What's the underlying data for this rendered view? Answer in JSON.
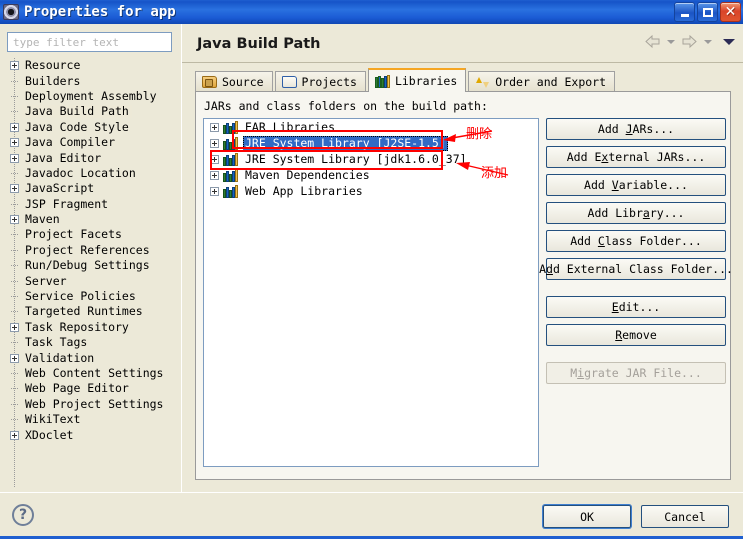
{
  "window": {
    "title": "Properties for app",
    "icon": "properties-gear-icon",
    "controls": {
      "minimize": "minimize",
      "maximize": "maximize",
      "close": "close"
    }
  },
  "sidebar": {
    "filter": {
      "placeholder": "type filter text",
      "value": ""
    },
    "items": [
      {
        "label": "Resource",
        "expandable": true,
        "selected": false
      },
      {
        "label": "Builders",
        "expandable": false,
        "selected": false
      },
      {
        "label": "Deployment Assembly",
        "expandable": false,
        "selected": false
      },
      {
        "label": "Java Build Path",
        "expandable": false,
        "selected": true
      },
      {
        "label": "Java Code Style",
        "expandable": true,
        "selected": false
      },
      {
        "label": "Java Compiler",
        "expandable": true,
        "selected": false
      },
      {
        "label": "Java Editor",
        "expandable": true,
        "selected": false
      },
      {
        "label": "Javadoc Location",
        "expandable": false,
        "selected": false
      },
      {
        "label": "JavaScript",
        "expandable": true,
        "selected": false
      },
      {
        "label": "JSP Fragment",
        "expandable": false,
        "selected": false
      },
      {
        "label": "Maven",
        "expandable": true,
        "selected": false
      },
      {
        "label": "Project Facets",
        "expandable": false,
        "selected": false
      },
      {
        "label": "Project References",
        "expandable": false,
        "selected": false
      },
      {
        "label": "Run/Debug Settings",
        "expandable": false,
        "selected": false
      },
      {
        "label": "Server",
        "expandable": false,
        "selected": false
      },
      {
        "label": "Service Policies",
        "expandable": false,
        "selected": false
      },
      {
        "label": "Targeted Runtimes",
        "expandable": false,
        "selected": false
      },
      {
        "label": "Task Repository",
        "expandable": true,
        "selected": false
      },
      {
        "label": "Task Tags",
        "expandable": false,
        "selected": false
      },
      {
        "label": "Validation",
        "expandable": true,
        "selected": false
      },
      {
        "label": "Web Content Settings",
        "expandable": false,
        "selected": false
      },
      {
        "label": "Web Page Editor",
        "expandable": false,
        "selected": false
      },
      {
        "label": "Web Project Settings",
        "expandable": false,
        "selected": false
      },
      {
        "label": "WikiText",
        "expandable": false,
        "selected": false
      },
      {
        "label": "XDoclet",
        "expandable": true,
        "selected": false
      }
    ]
  },
  "main": {
    "page_title": "Java Build Path",
    "nav": {
      "back_icon": "back-arrow-icon",
      "back_dropdown_icon": "chevron-down-icon",
      "forward_icon": "forward-arrow-icon",
      "forward_dropdown_icon": "chevron-down-icon",
      "menu_icon": "view-menu-chevron-icon"
    },
    "tabs": [
      {
        "label": "Source",
        "icon": "source-folder-icon",
        "active": false
      },
      {
        "label": "Projects",
        "icon": "projects-folder-icon",
        "active": false
      },
      {
        "label": "Libraries",
        "icon": "libraries-books-icon",
        "active": true
      },
      {
        "label": "Order and Export",
        "icon": "order-export-arrows-icon",
        "active": false
      }
    ],
    "panel_label": "JARs and class folders on the build path:",
    "libraries": [
      {
        "label": "EAR Libraries",
        "selected": false
      },
      {
        "label": "JRE System Library [J2SE-1.5]",
        "selected": true
      },
      {
        "label": "JRE System Library [jdk1.6.0_37]",
        "selected": false
      },
      {
        "label": "Maven Dependencies",
        "selected": false
      },
      {
        "label": "Web App Libraries",
        "selected": false
      }
    ],
    "buttons": [
      {
        "label": "Add JARs...",
        "mnemonic": "J",
        "disabled": false
      },
      {
        "label": "Add External JARs...",
        "mnemonic": "x",
        "disabled": false
      },
      {
        "label": "Add Variable...",
        "mnemonic": "V",
        "disabled": false
      },
      {
        "label": "Add Library...",
        "mnemonic": "a",
        "disabled": false
      },
      {
        "label": "Add Class Folder...",
        "mnemonic": "C",
        "disabled": false
      },
      {
        "label": "Add External Class Folder...",
        "mnemonic": "d",
        "disabled": false
      },
      {
        "label": "Edit...",
        "mnemonic": "E",
        "disabled": false
      },
      {
        "label": "Remove",
        "mnemonic": "R",
        "disabled": false
      },
      {
        "label": "Migrate JAR File...",
        "mnemonic": "i",
        "disabled": true
      }
    ]
  },
  "annotations": {
    "color": "#ff0000",
    "items": [
      {
        "text": "删除",
        "target": "JRE System Library [J2SE-1.5]"
      },
      {
        "text": "添加",
        "target": "JRE System Library [jdk1.6.0_37]"
      }
    ]
  },
  "footer": {
    "help_icon": "help-question-icon",
    "ok_label": "OK",
    "cancel_label": "Cancel"
  }
}
